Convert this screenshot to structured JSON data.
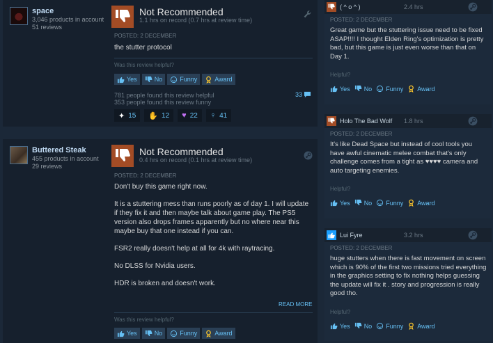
{
  "reviews": [
    {
      "author": "space",
      "products": "3,046 products in account",
      "review_count": "51 reviews",
      "verdict": "Not Recommended",
      "hours": "1.1 hrs on record (0.7 hrs at review time)",
      "posted": "POSTED: 2 DECEMBER",
      "text": [
        "the stutter protocol"
      ],
      "helpful_prompt": "Was this review helpful?",
      "found_helpful": "781 people found this review helpful",
      "found_funny": "353 people found this review funny",
      "comments": "33",
      "awards": [
        {
          "glyph": "✦",
          "count": "15"
        },
        {
          "glyph": "✋",
          "count": "12"
        },
        {
          "glyph": "♥",
          "count": "22"
        },
        {
          "glyph": "♀",
          "count": "41"
        }
      ]
    },
    {
      "author": "Buttered Steak",
      "products": "455 products in account",
      "review_count": "29 reviews",
      "verdict": "Not Recommended",
      "hours": "0.4 hrs on record (0.1 hrs at review time)",
      "posted": "POSTED: 2 DECEMBER",
      "text": [
        "Don't buy this game right now.",
        "It is a stuttering mess than runs poorly as of day 1. I will update if they fix it and then maybe talk about game play. The PS5 version also drops frames apparently but no where near this maybe buy that one instead if you can.",
        "FSR2 really doesn't help at all for 4k with raytracing.",
        "No DLSS for Nvidia users.",
        "HDR is broken and doesn't work."
      ],
      "read_more": "READ MORE",
      "helpful_prompt": "Was this review helpful?"
    }
  ],
  "buttons": {
    "yes": "Yes",
    "no": "No",
    "funny": "Funny",
    "award": "Award"
  },
  "right_reviews": [
    {
      "author": "( ^ o ^ )",
      "hours": "2.4 hrs",
      "posted": "POSTED: 2 DECEMBER",
      "text": "Great game but the stuttering issue need to be fixed ASAP!!!! I thought Elden Ring's optimization is pretty bad, but this game is just even worse than that on Day 1.",
      "helpful_prompt": "Helpful?",
      "recommended": false
    },
    {
      "author": "Holo The Bad Wolf",
      "hours": "1.8 hrs",
      "posted": "POSTED: 2 DECEMBER",
      "text": "It's like Dead Space but instead of cool tools you have awful cinematic melee combat that's only challenge comes from a tight as ♥♥♥♥ camera and auto targeting enemies.",
      "helpful_prompt": "Helpful?",
      "recommended": false
    },
    {
      "author": "Lui Fyre",
      "hours": "3.2 hrs",
      "posted": "POSTED: 2 DECEMBER",
      "text": "huge stutters when there is fast movement on screen which is 90% of the first two missions tried everything in the graphics setting to fix nothing helps guessing the update will fix it . story and progression is really good tho.",
      "helpful_prompt": "Helpful?",
      "recommended": true
    }
  ],
  "colors": {
    "background": "#1b2838",
    "card": "#16202d",
    "not_recommended": "#a34c25",
    "recommended": "#1a9fff",
    "link": "#66c0f4"
  }
}
